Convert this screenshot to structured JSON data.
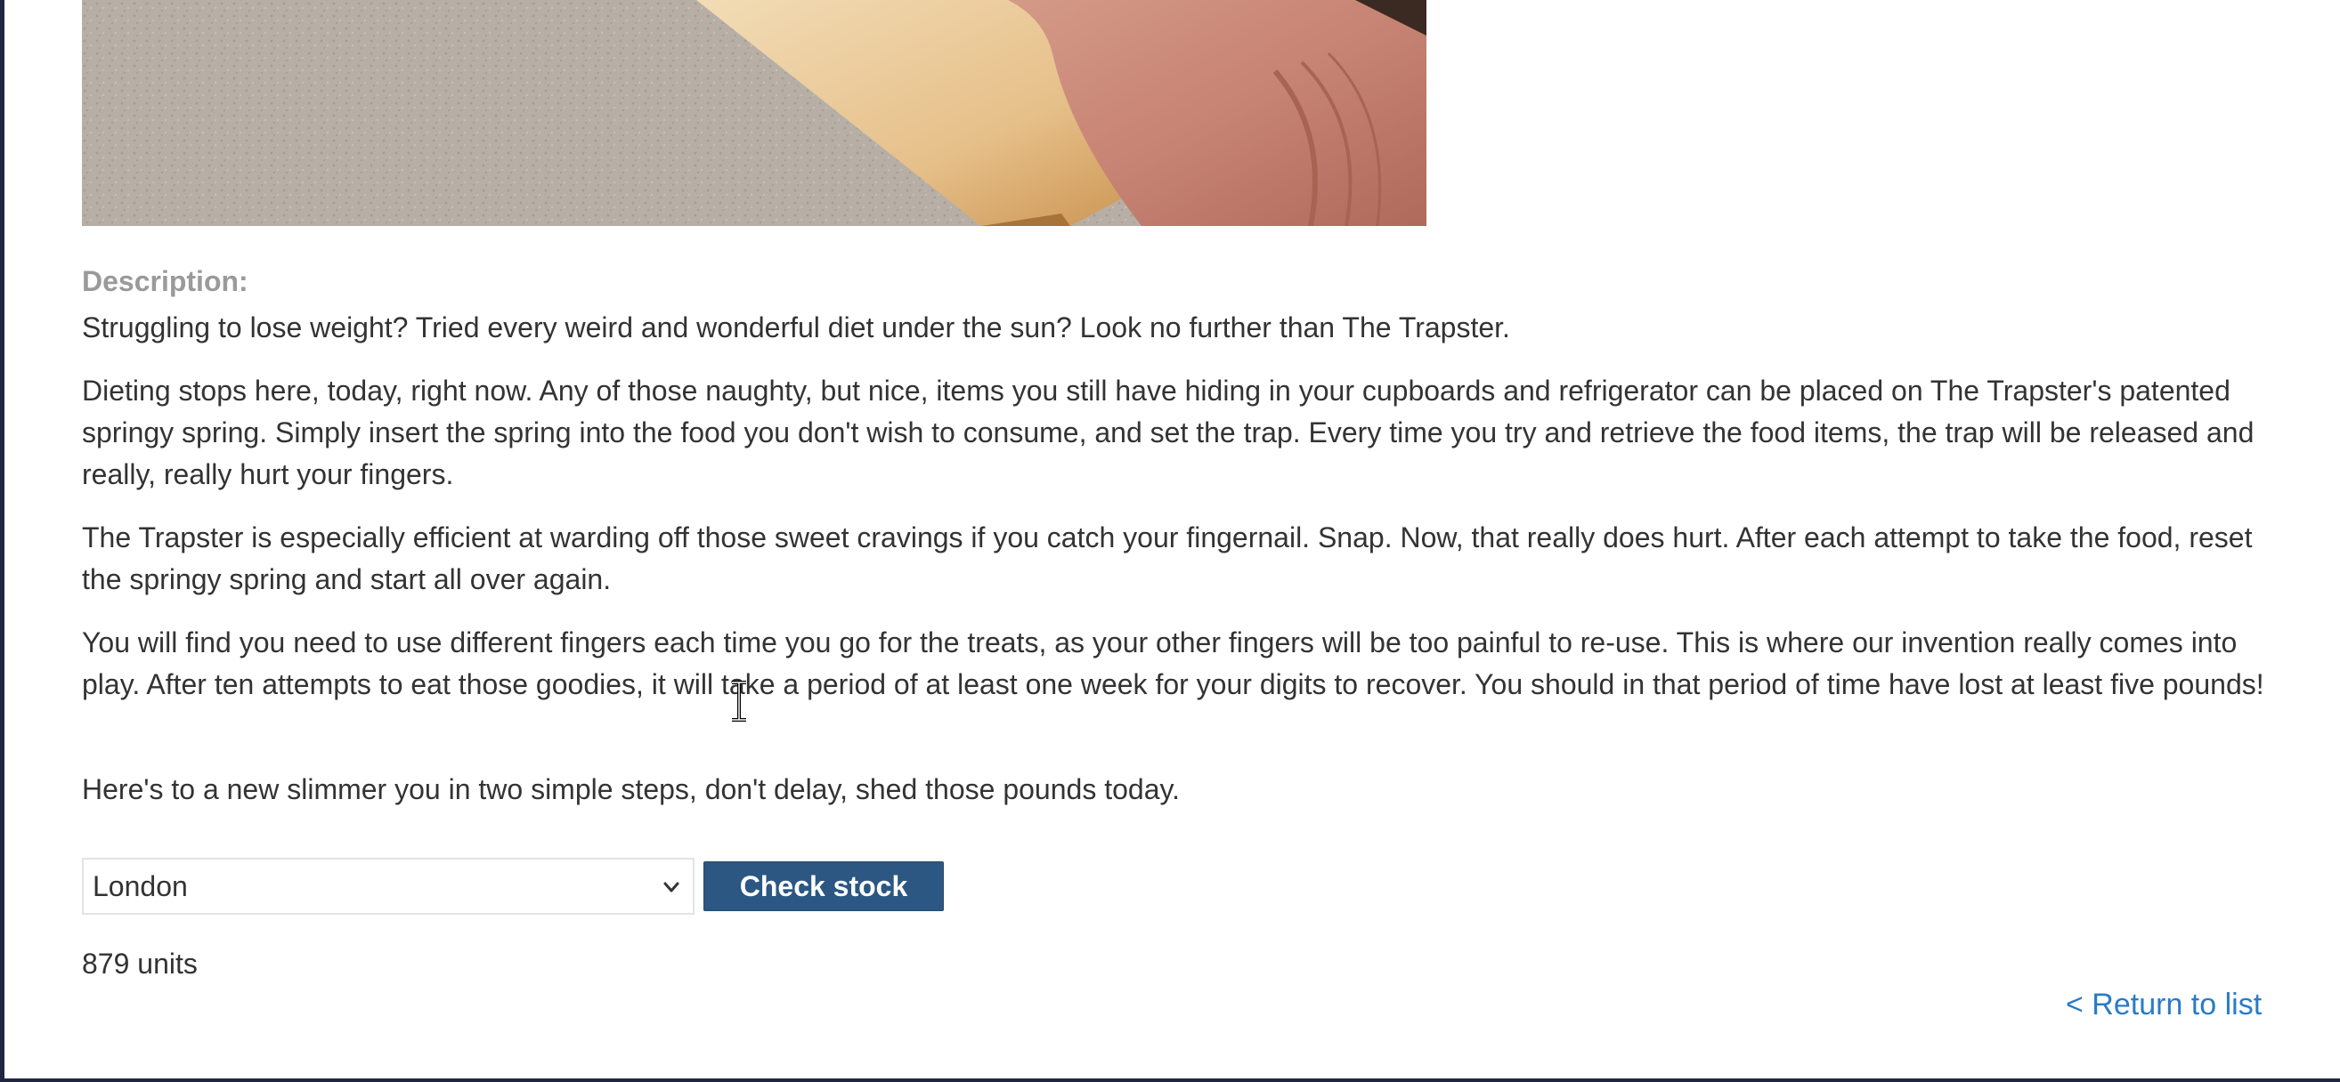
{
  "description": {
    "label": "Description:",
    "paragraphs": [
      "Struggling to lose weight? Tried every weird and wonderful diet under the sun? Look no further than The Trapster.",
      "Dieting stops here, today, right now. Any of those naughty, but nice, items you still have hiding in your cupboards and refrigerator can be placed on The Trapster's patented springy spring. Simply insert the spring into the food you don't wish to consume, and set the trap. Every time you try and retrieve the food items, the trap will be released and really, really hurt your fingers.",
      "The Trapster is especially efficient at warding off those sweet cravings if you catch your fingernail. Snap. Now, that really does hurt. After each attempt to take the food, reset the springy spring and start all over again.",
      "You will find you need to use different fingers each time you go for the treats, as your other fingers will be too painful to re-use. This is where our invention really comes into play. After ten attempts to eat those goodies, it will take a period of at least one week for your digits to recover. You should in that period of time have lost at least five pounds!",
      "Here's to a new slimmer you in two simple steps, don't delay, shed those pounds today."
    ]
  },
  "stock": {
    "store_selected": "London",
    "check_button": "Check stock",
    "result": "879 units"
  },
  "nav": {
    "return_link": "< Return to list"
  },
  "colors": {
    "button_bg": "#2b5782",
    "link": "#2a7bc7",
    "body_text": "#333333",
    "label_text": "#9a9a9a"
  },
  "icons": {
    "select_arrow": "chevron-down-icon",
    "cursor": "text-cursor-icon"
  }
}
